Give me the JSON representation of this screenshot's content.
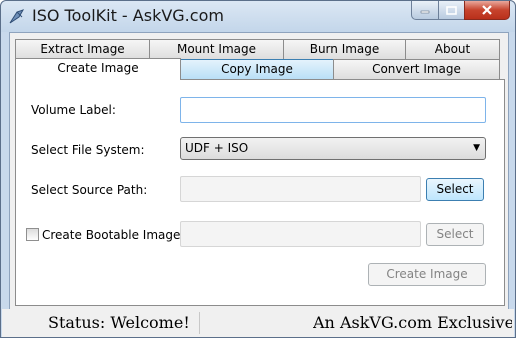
{
  "window": {
    "title": "ISO ToolKit - AskVG.com"
  },
  "tabs_row1": [
    {
      "label": "Extract Image"
    },
    {
      "label": "Mount Image"
    },
    {
      "label": "Burn Image"
    },
    {
      "label": "About"
    }
  ],
  "tabs_row2": [
    {
      "label": "Create Image",
      "state": "selected"
    },
    {
      "label": "Copy Image",
      "state": "hover"
    },
    {
      "label": "Convert Image"
    }
  ],
  "form": {
    "volume_label": {
      "label": "Volume Label:",
      "value": ""
    },
    "file_system": {
      "label": "Select File System:",
      "selected": "UDF + ISO"
    },
    "source_path": {
      "label": "Select Source Path:",
      "value": "",
      "button": "Select"
    },
    "bootable": {
      "label": "Create Bootable Image",
      "checked": false,
      "value": "",
      "button": "Select"
    },
    "create_button": "Create Image"
  },
  "status": {
    "left": "Status: Welcome!",
    "right": "An AskVG.com Exclusive Ap"
  },
  "colors": {
    "titlebar": "#c3d6ea",
    "close_button": "#c7432d",
    "hover_tab": "#b7def6"
  }
}
